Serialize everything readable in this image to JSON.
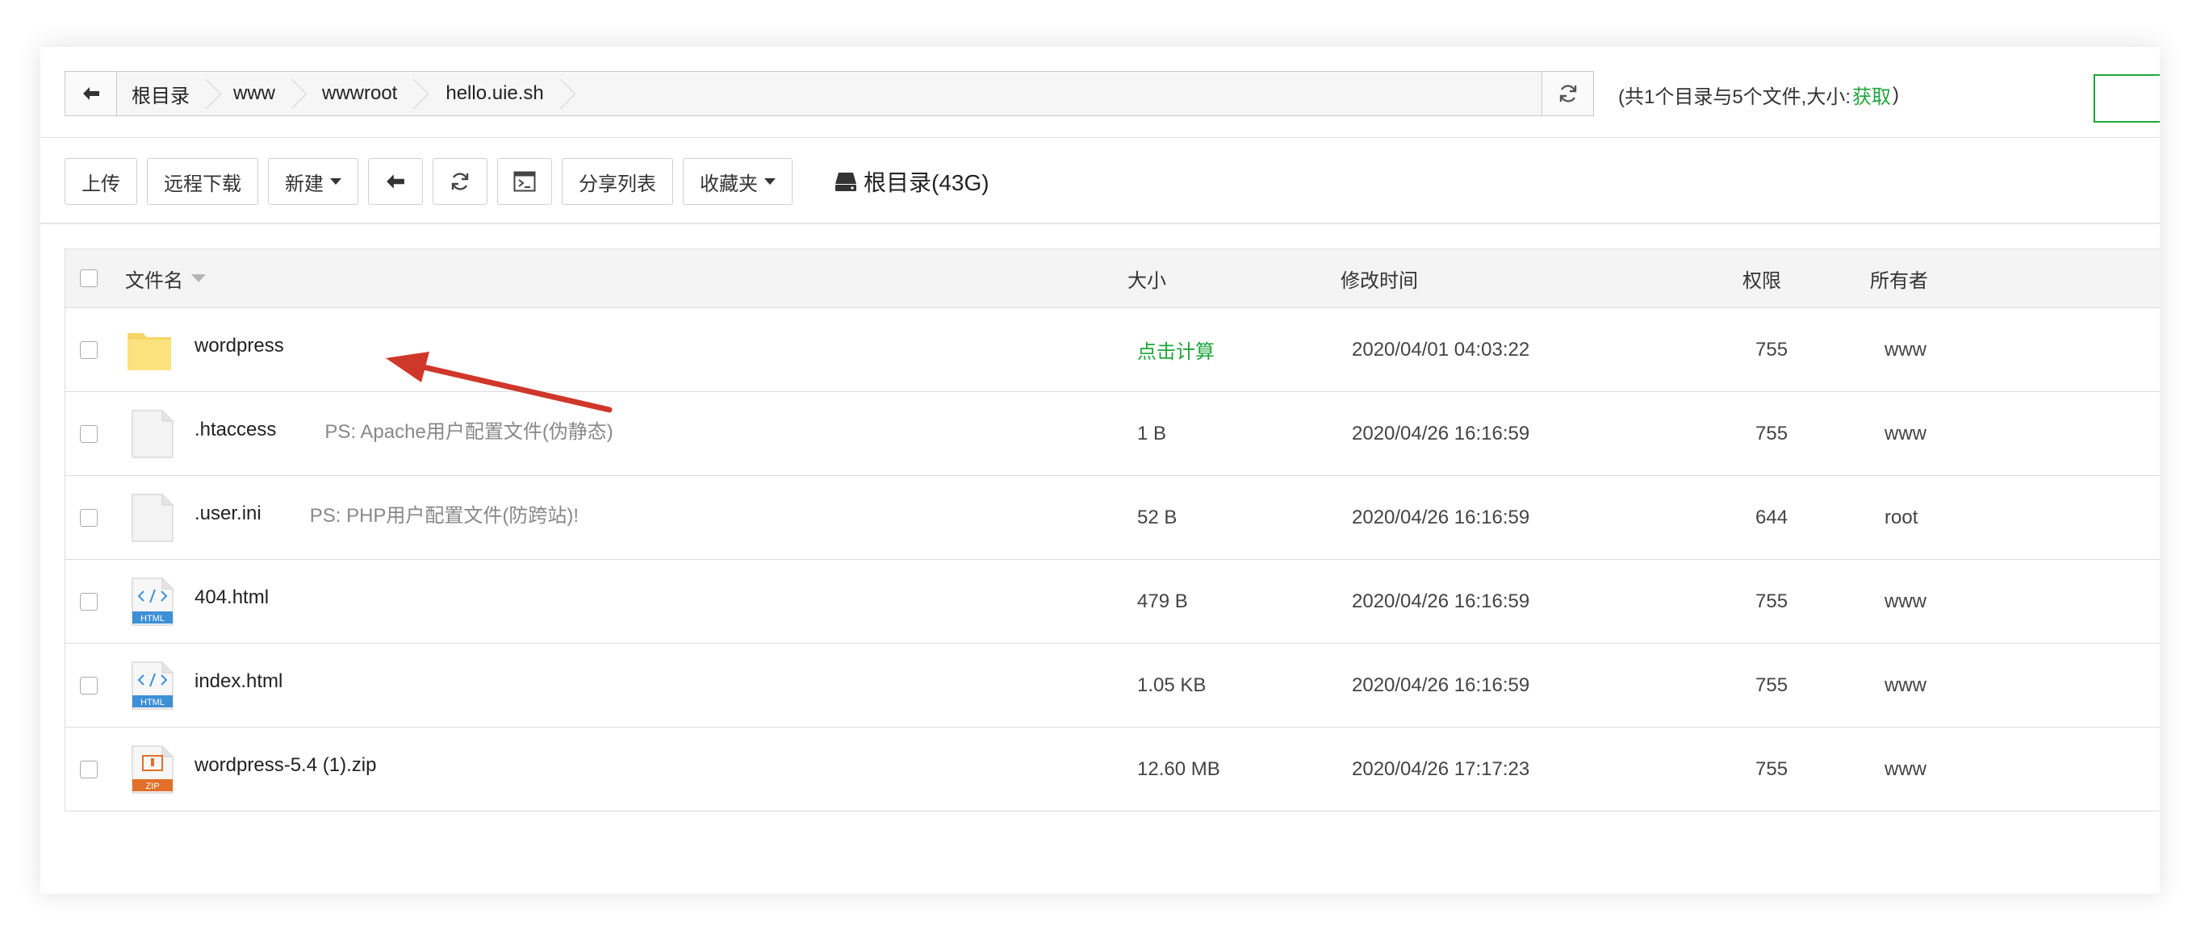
{
  "breadcrumb": {
    "items": [
      "根目录",
      "www",
      "wwwroot",
      "hello.uie.sh"
    ]
  },
  "summary": {
    "prefix": "(共1个目录与5个文件,大小: ",
    "fetch": "获取",
    "suffix": ")"
  },
  "toolbar": {
    "upload": "上传",
    "remote_download": "远程下载",
    "new": "新建",
    "share_list": "分享列表",
    "favorites": "收藏夹",
    "disk": "根目录(43G)"
  },
  "table": {
    "columns": {
      "name": "文件名",
      "size": "大小",
      "mtime": "修改时间",
      "perm": "权限",
      "owner": "所有者"
    },
    "rows": [
      {
        "type": "folder",
        "name": "wordpress",
        "ps": "",
        "size": "点击计算",
        "mtime": "2020/04/01 04:03:22",
        "perm": "755",
        "owner": "www"
      },
      {
        "type": "file",
        "name": ".htaccess",
        "ps": "PS: Apache用户配置文件(伪静态)",
        "size": "1 B",
        "mtime": "2020/04/26 16:16:59",
        "perm": "755",
        "owner": "www"
      },
      {
        "type": "file",
        "name": ".user.ini",
        "ps": "PS: PHP用户配置文件(防跨站)!",
        "size": "52 B",
        "mtime": "2020/04/26 16:16:59",
        "perm": "644",
        "owner": "root"
      },
      {
        "type": "html",
        "name": "404.html",
        "ps": "",
        "size": "479 B",
        "mtime": "2020/04/26 16:16:59",
        "perm": "755",
        "owner": "www"
      },
      {
        "type": "html",
        "name": "index.html",
        "ps": "",
        "size": "1.05 KB",
        "mtime": "2020/04/26 16:16:59",
        "perm": "755",
        "owner": "www"
      },
      {
        "type": "zip",
        "name": "wordpress-5.4 (1).zip",
        "ps": "",
        "size": "12.60 MB",
        "mtime": "2020/04/26 17:17:23",
        "perm": "755",
        "owner": "www"
      }
    ]
  },
  "icons": {
    "html_badge": "HTML",
    "zip_badge": "ZIP"
  },
  "colors": {
    "accent_green": "#20a53a",
    "arrow_red": "#d0372b",
    "folder_yellow": "#fbe27c"
  }
}
